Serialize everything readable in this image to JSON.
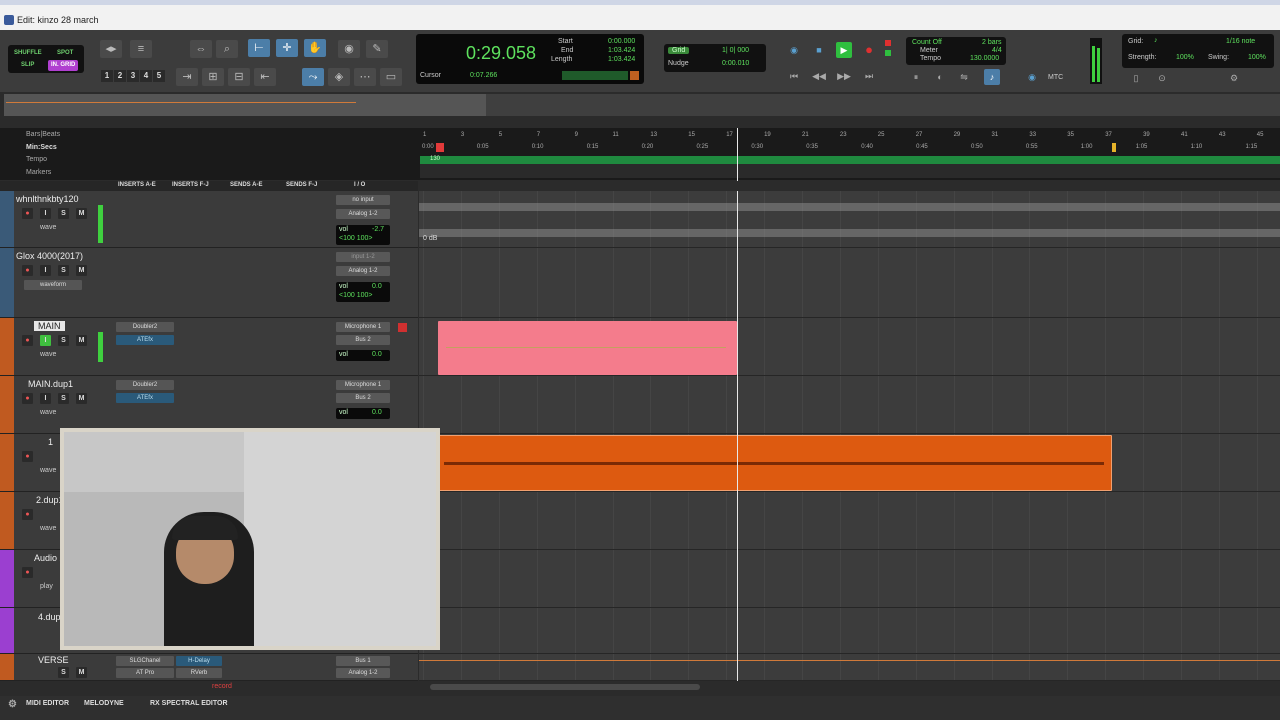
{
  "window": {
    "title": "Edit: kinzo 28 march"
  },
  "toolbar": {
    "modes": {
      "shuffle": "SHUFFLE",
      "spot": "SPOT",
      "slip": "SLIP",
      "grid": "IN. GRID"
    },
    "zoom_presets": [
      "1",
      "2",
      "3",
      "4",
      "5"
    ],
    "counter": {
      "main": "0:29.058",
      "start_label": "Start",
      "end_label": "End",
      "length_label": "Length",
      "start": "0:00.000",
      "end": "1:03.424",
      "length": "1:03.424",
      "cursor_label": "Cursor",
      "cursor": "0:07.266"
    },
    "grid_nudge": {
      "grid_label": "Grid",
      "grid_value": "1| 0| 000",
      "nudge_label": "Nudge",
      "nudge_value": "0:00.010"
    },
    "count_meter": {
      "count_off": "Count Off",
      "meter": "Meter",
      "tempo": "Tempo",
      "bars": "2 bars",
      "sig": "4/4",
      "bpm": "130.0000"
    },
    "right_panel": {
      "grid_label": "Grid:",
      "grid_value": "1/16 note",
      "strength_label": "Strength:",
      "strength": "100%",
      "swing_label": "Swing:",
      "swing": "100%"
    },
    "mtc": "MTC"
  },
  "ruler": {
    "labels": {
      "bars": "Bars|Beats",
      "minsecs": "Min:Secs",
      "tempo": "Tempo",
      "markers": "Markers"
    },
    "bar_ticks": [
      "1",
      "3",
      "5",
      "7",
      "9",
      "11",
      "13",
      "15",
      "17",
      "19",
      "21",
      "23",
      "25",
      "27",
      "29",
      "31",
      "33",
      "35",
      "37",
      "39",
      "41",
      "43",
      "45"
    ],
    "time_ticks": [
      "0:00",
      "0:05",
      "0:10",
      "0:15",
      "0:20",
      "0:25",
      "0:30",
      "0:35",
      "0:40",
      "0:45",
      "0:50",
      "0:55",
      "1:00",
      "1:05",
      "1:10",
      "1:15"
    ],
    "tempo_value": "130"
  },
  "columns": {
    "inserts_ae": "INSERTS A-E",
    "inserts_fj": "INSERTS F-J",
    "sends_ae": "SENDS A-E",
    "sends_fj": "SENDS F-J",
    "io": "I / O"
  },
  "tracks": [
    {
      "name": "whnlthnkbty120",
      "io_in": "no input",
      "io_out": "Analog 1-2",
      "vol": "-2.7",
      "pan": "<100  100>",
      "view": "wave",
      "color": "#5aa0d0"
    },
    {
      "name": "Glox 4000(2017)",
      "io_in": "input 1-2",
      "io_out": "Analog 1-2",
      "vol": "0.0",
      "pan": "<100  100>",
      "view": "waveform",
      "color": "#5aa0d0"
    },
    {
      "name": "MAIN",
      "insert1": "Doubler2",
      "insert2": "ATEfx",
      "io_in": "Microphone 1",
      "io_out": "Bus 2",
      "vol": "0.0",
      "view": "wave",
      "color": "#e07a3a"
    },
    {
      "name": "MAIN.dup1",
      "insert1": "Doubler2",
      "insert2": "ATEfx",
      "io_in": "Microphone 1",
      "io_out": "Bus 2",
      "vol": "0.0",
      "view": "wave",
      "color": "#e07a3a"
    },
    {
      "name": "1",
      "view": "wave",
      "color": "#e07a3a"
    },
    {
      "name": "2.dup1",
      "view": "wave",
      "color": "#e07a3a"
    },
    {
      "name": "Audio 2",
      "view": "play",
      "color": "#9b3fd0"
    },
    {
      "name": "4.dup1",
      "color": "#9b3fd0"
    },
    {
      "name": "VERSE",
      "insert1": "SLGChanel",
      "insert1b": "H-Delay",
      "insert2": "AT Pro",
      "insert2b": "RVerb",
      "io_in": "Bus 1",
      "io_out": "Analog 1-2",
      "color": "#e07a3a"
    }
  ],
  "misc": {
    "record_label": "record",
    "clip_gain": "0 dB"
  },
  "bottom_tabs": [
    "MIDI EDITOR",
    "MELODYNE",
    "RX SPECTRAL EDITOR"
  ],
  "colors": {
    "pink_clip": "#f47c8c",
    "orange_clip": "#dd5a10",
    "playhead": "#e8e8e8"
  }
}
